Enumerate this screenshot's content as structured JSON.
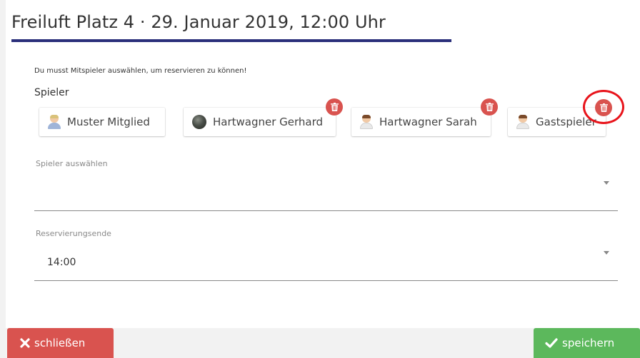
{
  "dialog": {
    "title": "Freiluft Platz 4 · 29. Januar 2019, 12:00 Uhr",
    "hint": "Du musst Mitspieler auswählen, um reservieren zu können!",
    "players_label": "Spieler",
    "players": [
      {
        "name": "Muster Mitglied",
        "avatar": "male-avatar-icon",
        "removable": false
      },
      {
        "name": "Hartwagner Gerhard",
        "avatar": "photo-avatar",
        "removable": true
      },
      {
        "name": "Hartwagner Sarah",
        "avatar": "female-avatar-icon",
        "removable": true
      },
      {
        "name": "Gastspieler",
        "avatar": "female-avatar-icon",
        "removable": true
      }
    ],
    "player_select": {
      "label": "Spieler auswählen",
      "value": ""
    },
    "end_select": {
      "label": "Reservierungsende",
      "value": "14:00"
    }
  },
  "buttons": {
    "close_label": "schließen",
    "save_label": "speichern"
  },
  "colors": {
    "accent_underline": "#2a2f7a",
    "danger": "#d9534f",
    "success": "#5cb85c",
    "highlight_ring": "#e8141b"
  }
}
